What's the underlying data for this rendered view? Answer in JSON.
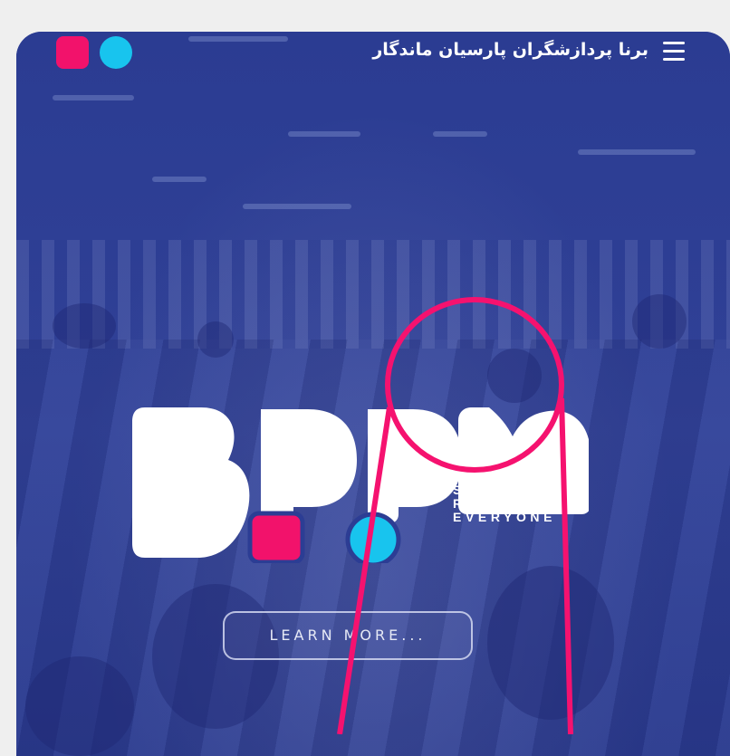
{
  "header": {
    "title": "برنا پردازشگران پارسیان ماندگار",
    "menu_icon": "hamburger-menu-icon",
    "logo_icon": "bpm-mini-logo-icon"
  },
  "hero": {
    "logo_letters": "BPM",
    "tagline": [
      "SERVICES AND",
      "REVENUE FOR",
      "EVERYONE"
    ],
    "button_label": "LEARN MORE..."
  },
  "colors": {
    "brand_blue": "#2c3d94",
    "pink": "#f2126b",
    "cyan": "#18c4ee",
    "annotation": "#f5126f"
  }
}
